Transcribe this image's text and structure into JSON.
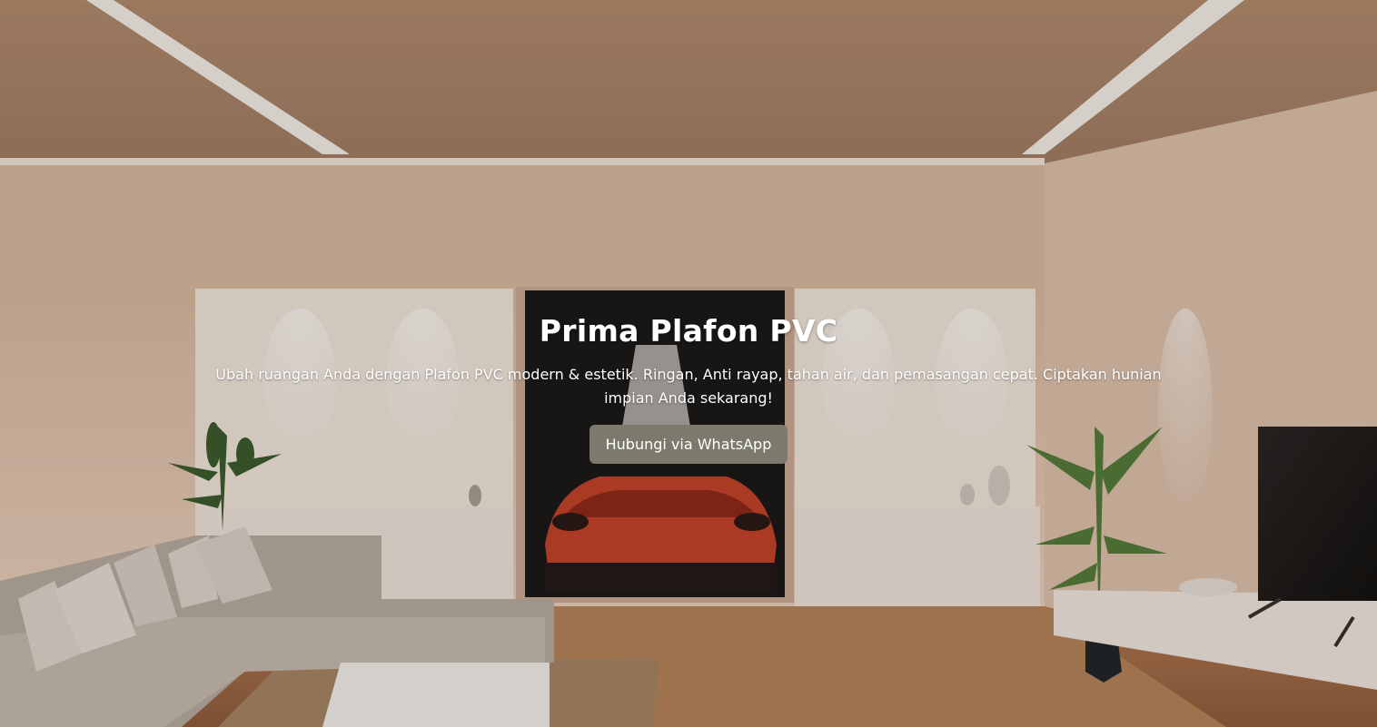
{
  "hero": {
    "title": "Prima Plafon PVC",
    "subtitle": "Ubah ruangan Anda dengan Plafon PVC modern & estetik. Ringan, Anti rayap, tahan air, dan pemasangan cepat. Ciptakan hunian impian Anda sekarang!",
    "cta_label": "Hubungi via WhatsApp"
  },
  "colors": {
    "cta_background": "#7c7a6c",
    "text": "#ffffff",
    "ceiling": "#a98468",
    "wall": "#e8cdb7",
    "floor": "#b07a55"
  }
}
